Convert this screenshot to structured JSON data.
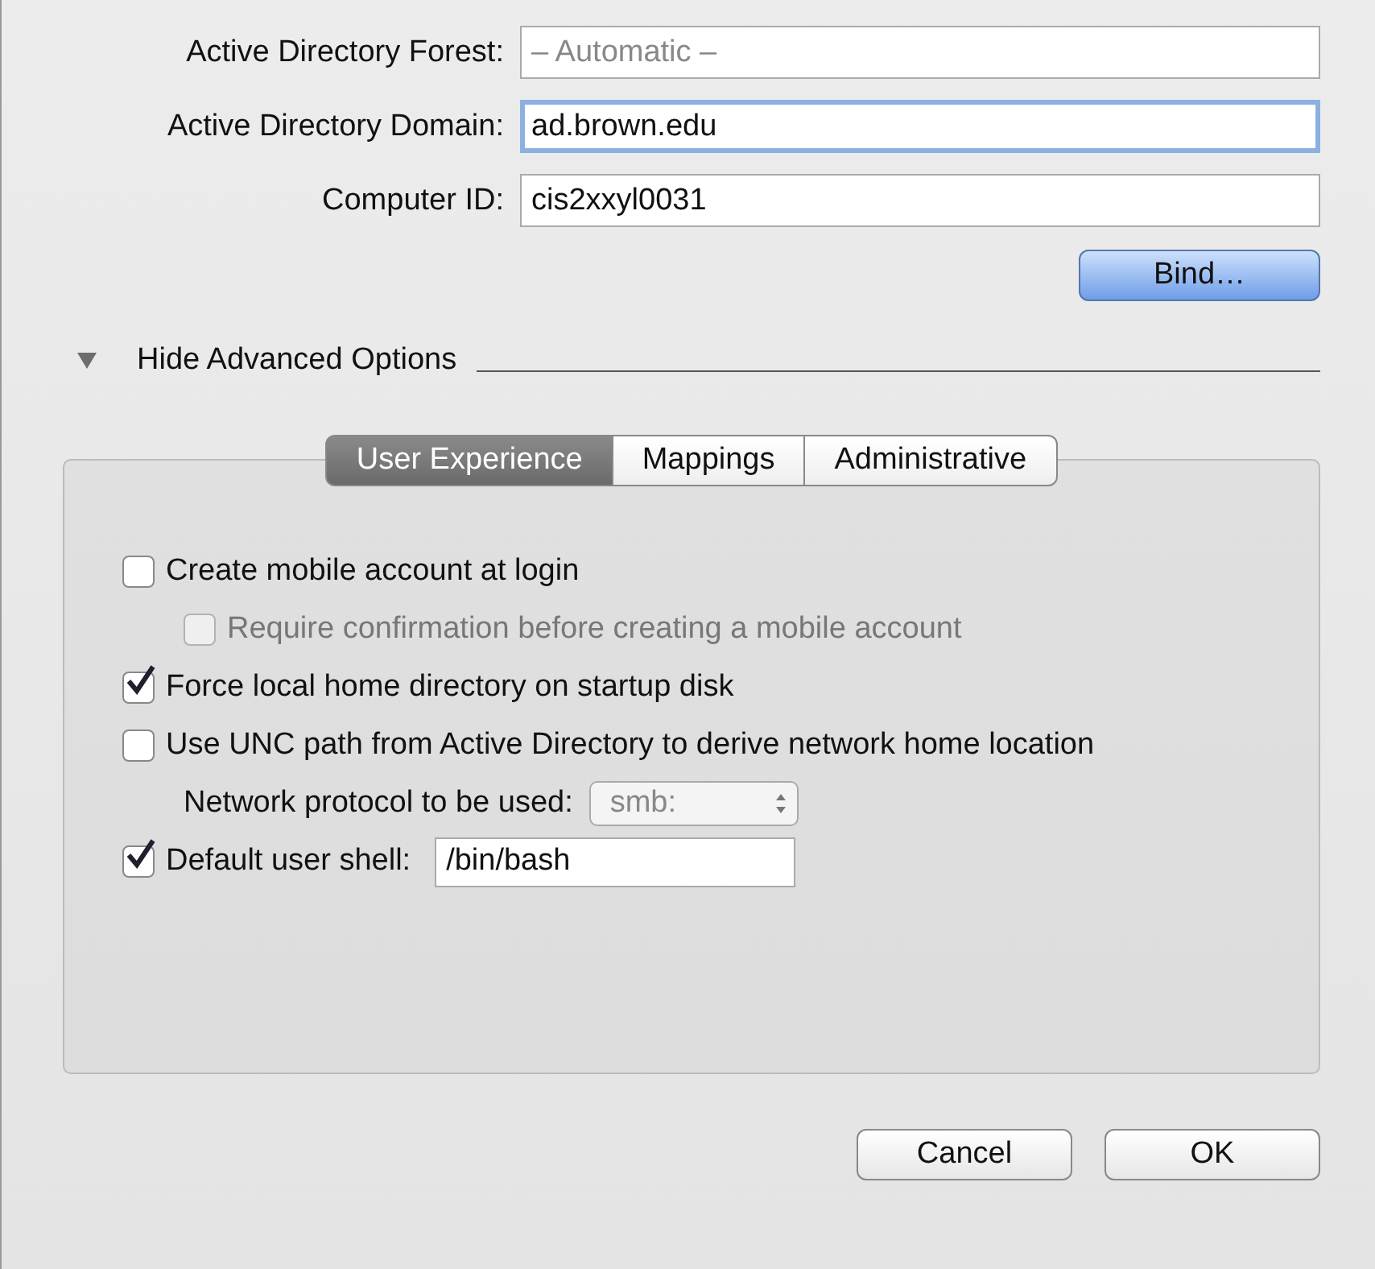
{
  "fields": [
    {
      "label": "Active Directory Forest:",
      "placeholder": "– Automatic –",
      "focused": false
    },
    {
      "label": "Active Directory Domain:",
      "value": "ad.brown.edu",
      "focused": true
    },
    {
      "label": "Computer ID:",
      "value": "cis2xxyl0031",
      "focused": false
    }
  ],
  "bind_button": "Bind…",
  "advanced": {
    "label": "Hide Advanced Options",
    "expanded": true
  },
  "tabs": [
    {
      "label": "User Experience",
      "selected": true
    },
    {
      "label": "Mappings",
      "selected": false
    },
    {
      "label": "Administrative",
      "selected": false
    }
  ],
  "options": [
    {
      "kind": "checkbox",
      "label": "Create mobile account at login",
      "checked": false,
      "disabled": false,
      "children": [
        {
          "kind": "checkbox",
          "label": "Require confirmation before creating a mobile account",
          "checked": false,
          "disabled": true
        }
      ]
    },
    {
      "kind": "checkbox",
      "label": "Force local home directory on startup disk",
      "checked": true,
      "disabled": false
    },
    {
      "kind": "checkbox",
      "label": "Use UNC path from Active Directory to derive network home location",
      "checked": false,
      "disabled": false,
      "children": [
        {
          "kind": "popup",
          "label": "Network protocol to be used:",
          "value": "smb:",
          "disabled": true
        }
      ]
    },
    {
      "kind": "checkbox-field",
      "label": "Default user shell:",
      "checked": true,
      "disabled": false,
      "value": "/bin/bash"
    }
  ],
  "buttons": [
    {
      "label": "Cancel",
      "default": false
    },
    {
      "label": "OK",
      "default": false
    }
  ]
}
